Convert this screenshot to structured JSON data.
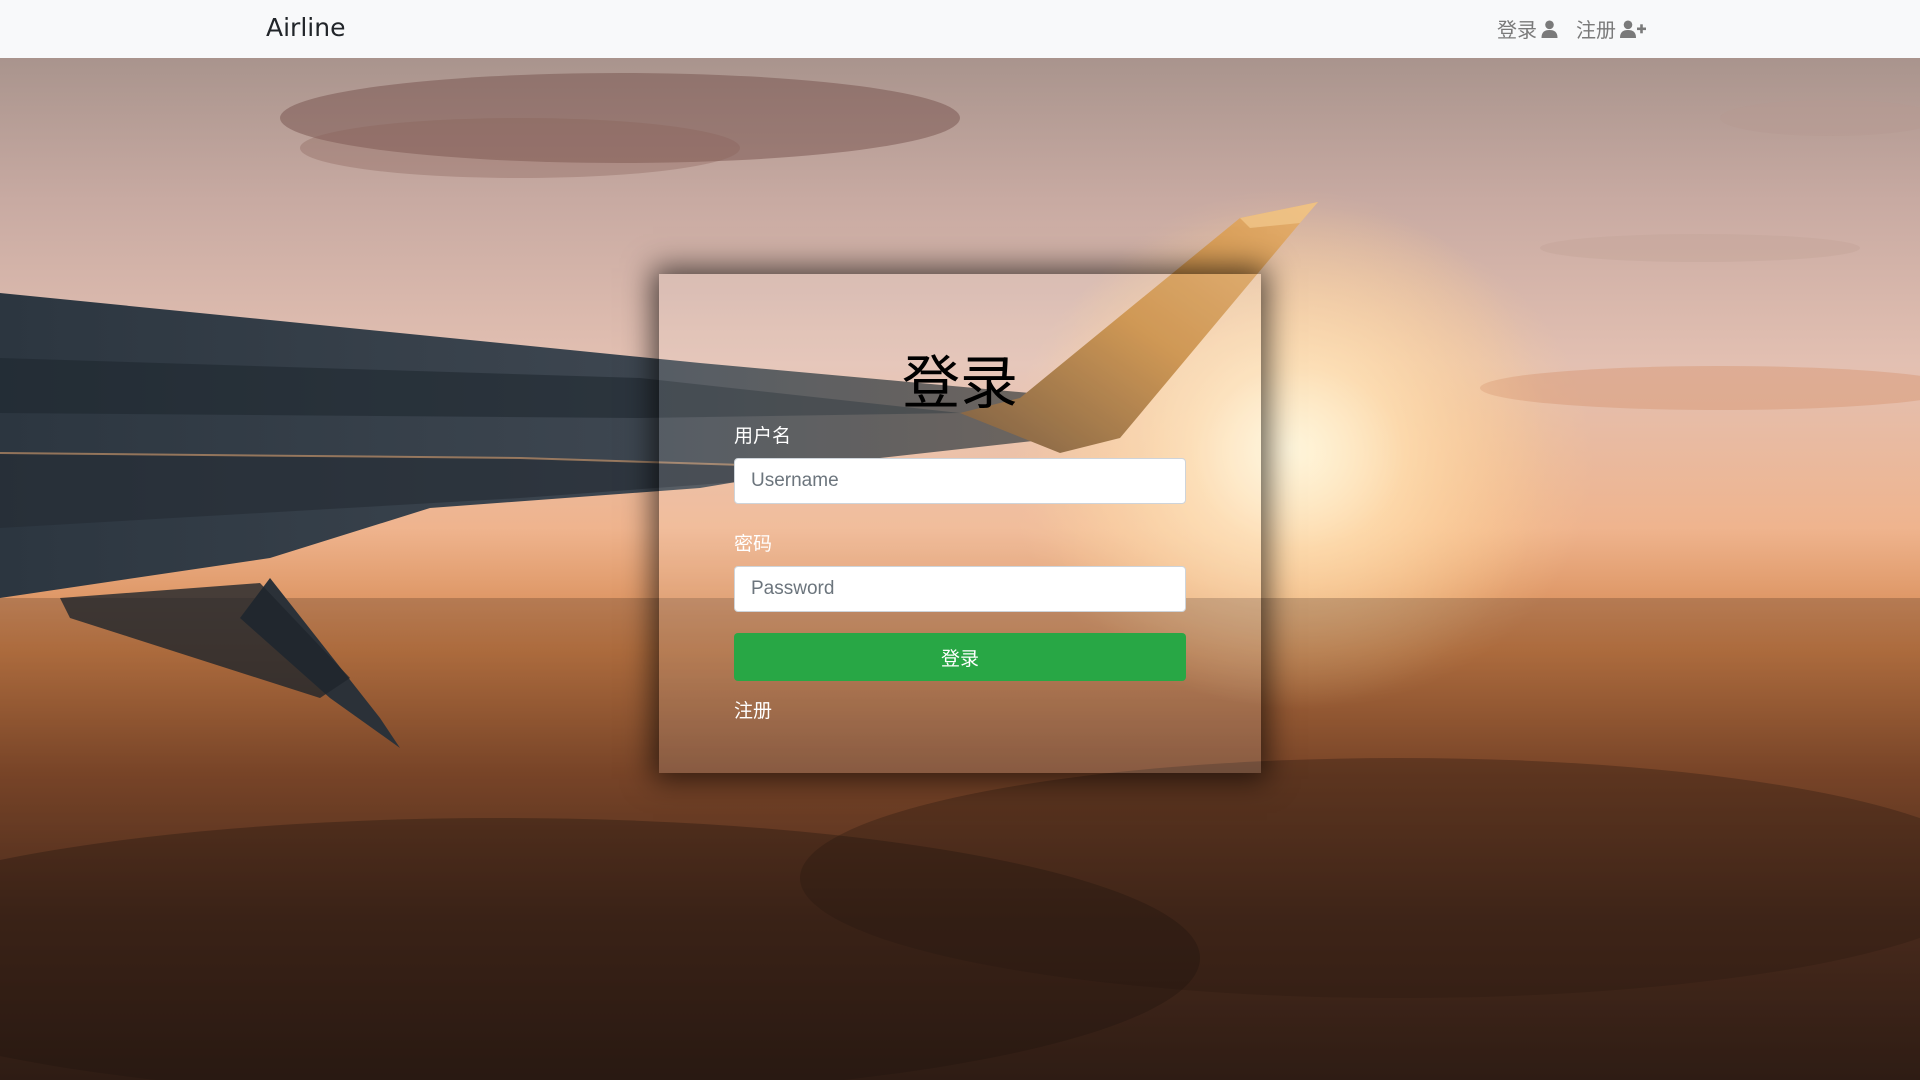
{
  "navbar": {
    "brand": "Airline",
    "links": [
      {
        "label": "登录",
        "icon": "user-icon"
      },
      {
        "label": "注册",
        "icon": "user-plus-icon"
      }
    ]
  },
  "login_form": {
    "title": "登录",
    "username": {
      "label": "用户名",
      "placeholder": "Username",
      "value": ""
    },
    "password": {
      "label": "密码",
      "placeholder": "Password",
      "value": ""
    },
    "submit_label": "登录",
    "register_link": "注册",
    "submit_color": "#28a745"
  },
  "background": {
    "image": "airplane-wing-sunset"
  }
}
